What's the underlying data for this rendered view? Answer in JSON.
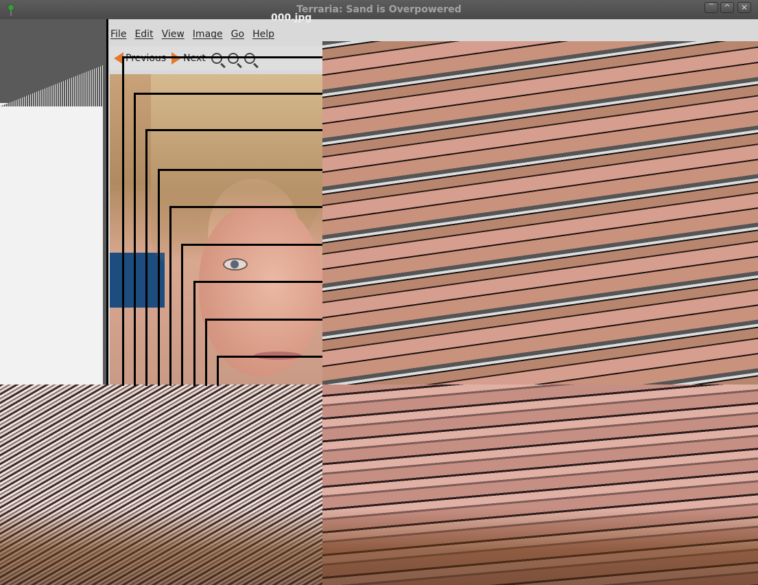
{
  "window": {
    "title": "Terraria: Sand is Overpowered",
    "buttons": [
      "‾",
      "^",
      "✕"
    ]
  },
  "viewer": {
    "title": "000.jpg",
    "menu": [
      "File",
      "Edit",
      "View",
      "Image",
      "Go",
      "Help"
    ],
    "toolbar": {
      "previous": "Previous",
      "next": "Next"
    }
  },
  "watermark": ""
}
